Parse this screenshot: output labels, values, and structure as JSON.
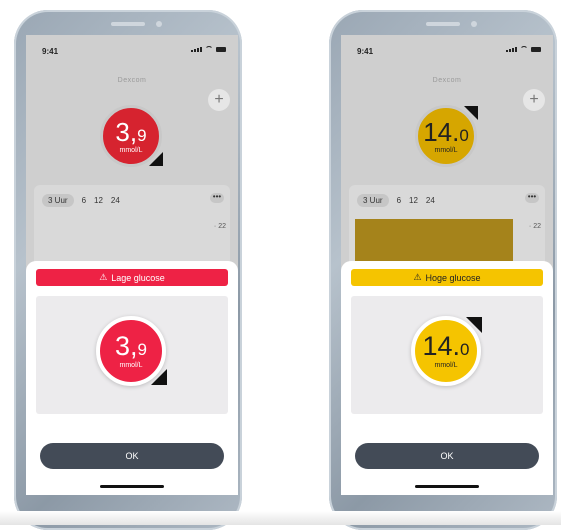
{
  "phones": [
    {
      "status_time": "9:41",
      "brand": "Dexcom",
      "add_label": "+",
      "reading_main": "3,",
      "reading_decimal": "9",
      "unit": "mmol/L",
      "range_tabs": [
        "3 Uur",
        "6",
        "12",
        "24"
      ],
      "more_label": "•••",
      "y_tick": "22",
      "alert_title": "Lage glucose",
      "ok_label": "OK",
      "trend_icon": "trend-arrow-down-icon",
      "alert_color": "#ee2245"
    },
    {
      "status_time": "9:41",
      "brand": "Dexcom",
      "add_label": "+",
      "reading_main": "14.",
      "reading_decimal": "0",
      "unit": "mmol/L",
      "range_tabs": [
        "3 Uur",
        "6",
        "12",
        "24"
      ],
      "more_label": "•••",
      "y_tick": "22",
      "alert_title": "Hoge glucose",
      "ok_label": "OK",
      "trend_icon": "trend-arrow-up-icon",
      "alert_color": "#f5c400"
    }
  ],
  "warning_icon": "⚠"
}
